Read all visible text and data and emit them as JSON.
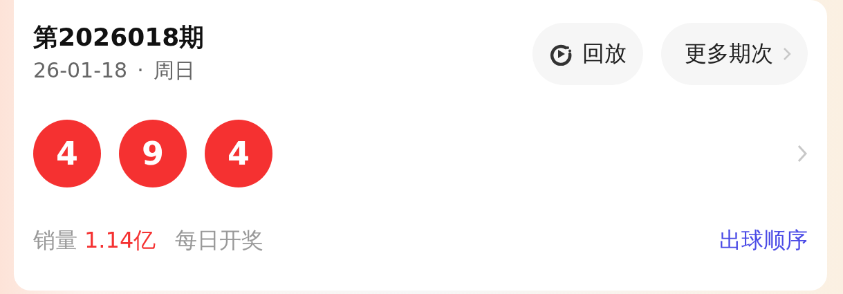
{
  "draw": {
    "title": "第2026018期",
    "date": "26-01-18",
    "separator": "·",
    "weekday": "周日"
  },
  "buttons": [
    {
      "kind": "replay",
      "label": "回放"
    },
    {
      "kind": "more",
      "label": "更多期次"
    }
  ],
  "balls": [
    "4",
    "9",
    "4"
  ],
  "sales": {
    "label": "销量",
    "value": "1.14亿"
  },
  "schedule": "每日开奖",
  "order_link": "出球顺序"
}
